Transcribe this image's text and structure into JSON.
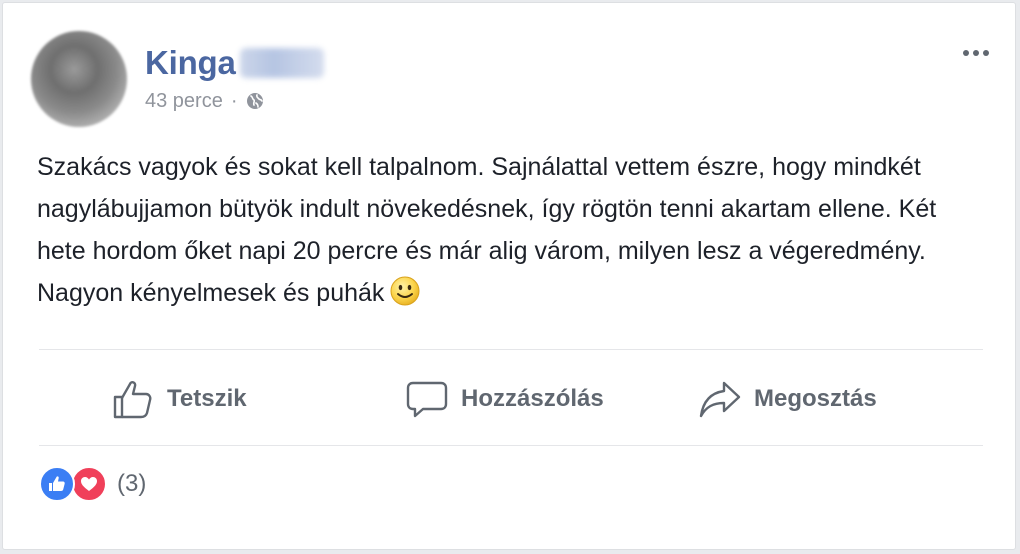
{
  "post": {
    "author_name": "Kinga",
    "timestamp": "43 perce",
    "meta_separator": "·",
    "privacy_icon": "globe-icon",
    "body_text": "Szakács vagyok és sokat kell talpalnom. Sajnálattal vettem észre, hogy mindkét nagylábujjamon bütyök indult növekedésnek, így rögtön tenni akartam ellene. Két hete hordom őket napi 20 percre és már alig várom, milyen lesz a végeredmény. Nagyon kényelmesek és puhák",
    "body_emoji": "smiley-emoji-icon"
  },
  "actions": {
    "like_label": "Tetszik",
    "comment_label": "Hozzászólás",
    "share_label": "Megosztás"
  },
  "reactions": {
    "types": [
      "like-reaction-icon",
      "love-reaction-icon"
    ],
    "count_label": "(3)"
  },
  "colors": {
    "author_link": "#4b67a1",
    "meta_text": "#90949c",
    "body_text": "#1d2129",
    "action_text": "#606770",
    "like_blue": "#3b7ef4",
    "love_red": "#f0405a"
  }
}
